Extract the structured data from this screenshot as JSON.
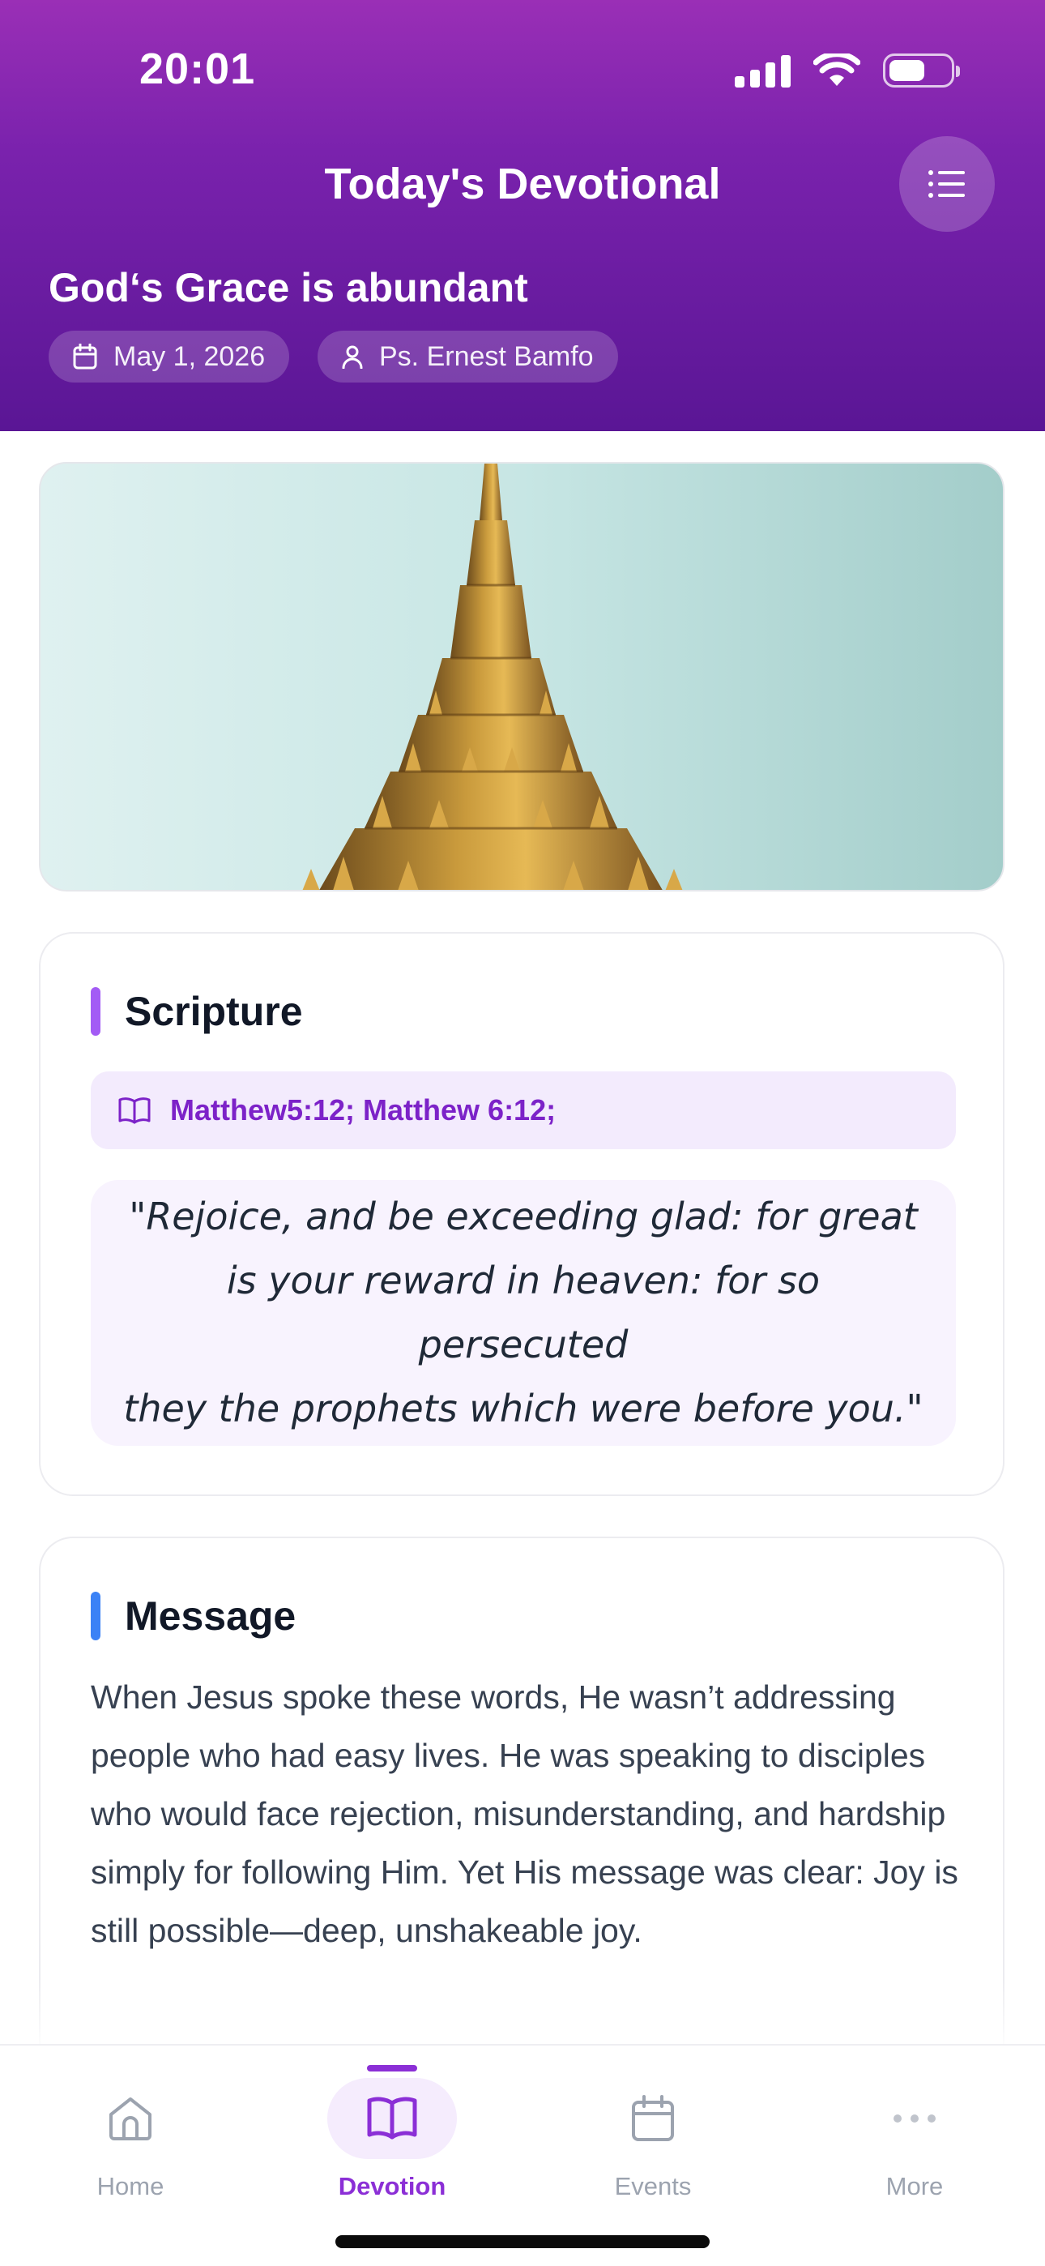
{
  "status_bar": {
    "time": "20:01",
    "battery_level": 0.6
  },
  "header": {
    "title": "Today's Devotional",
    "menu_icon": "list-icon",
    "devotion_title": "God‘s Grace is abundant",
    "date": "May 1, 2026",
    "author": "Ps. Ernest Bamfo",
    "gradient": [
      "#9a2fb6",
      "#5a1695"
    ]
  },
  "hero_image": {
    "subject": "temple-spire-image"
  },
  "scripture": {
    "heading": "Scripture",
    "accent_color": "#a35bf5",
    "reference": "Matthew5:12; Matthew 6:12;",
    "quote_lines": [
      "\"Rejoice, and be exceeding glad: for great",
      "is your reward in heaven: for so persecuted",
      "they the prophets which were before you.\""
    ]
  },
  "message": {
    "heading": "Message",
    "accent_color": "#3b82f6",
    "body": "When Jesus spoke these words, He wasn’t addressing people who had easy lives. He was speaking to disciples who would face rejection, misunderstanding, and hardship simply for following Him. Yet His message was clear: Joy is still possible—deep, unshakeable joy."
  },
  "bottom_nav": {
    "items": [
      {
        "label": "Home",
        "icon": "home-icon",
        "active": false
      },
      {
        "label": "Devotion",
        "icon": "book-open-icon",
        "active": true
      },
      {
        "label": "Events",
        "icon": "calendar-icon",
        "active": false
      },
      {
        "label": "More",
        "icon": "more-dots-icon",
        "active": false
      }
    ],
    "active_color": "#8b2fd6"
  }
}
